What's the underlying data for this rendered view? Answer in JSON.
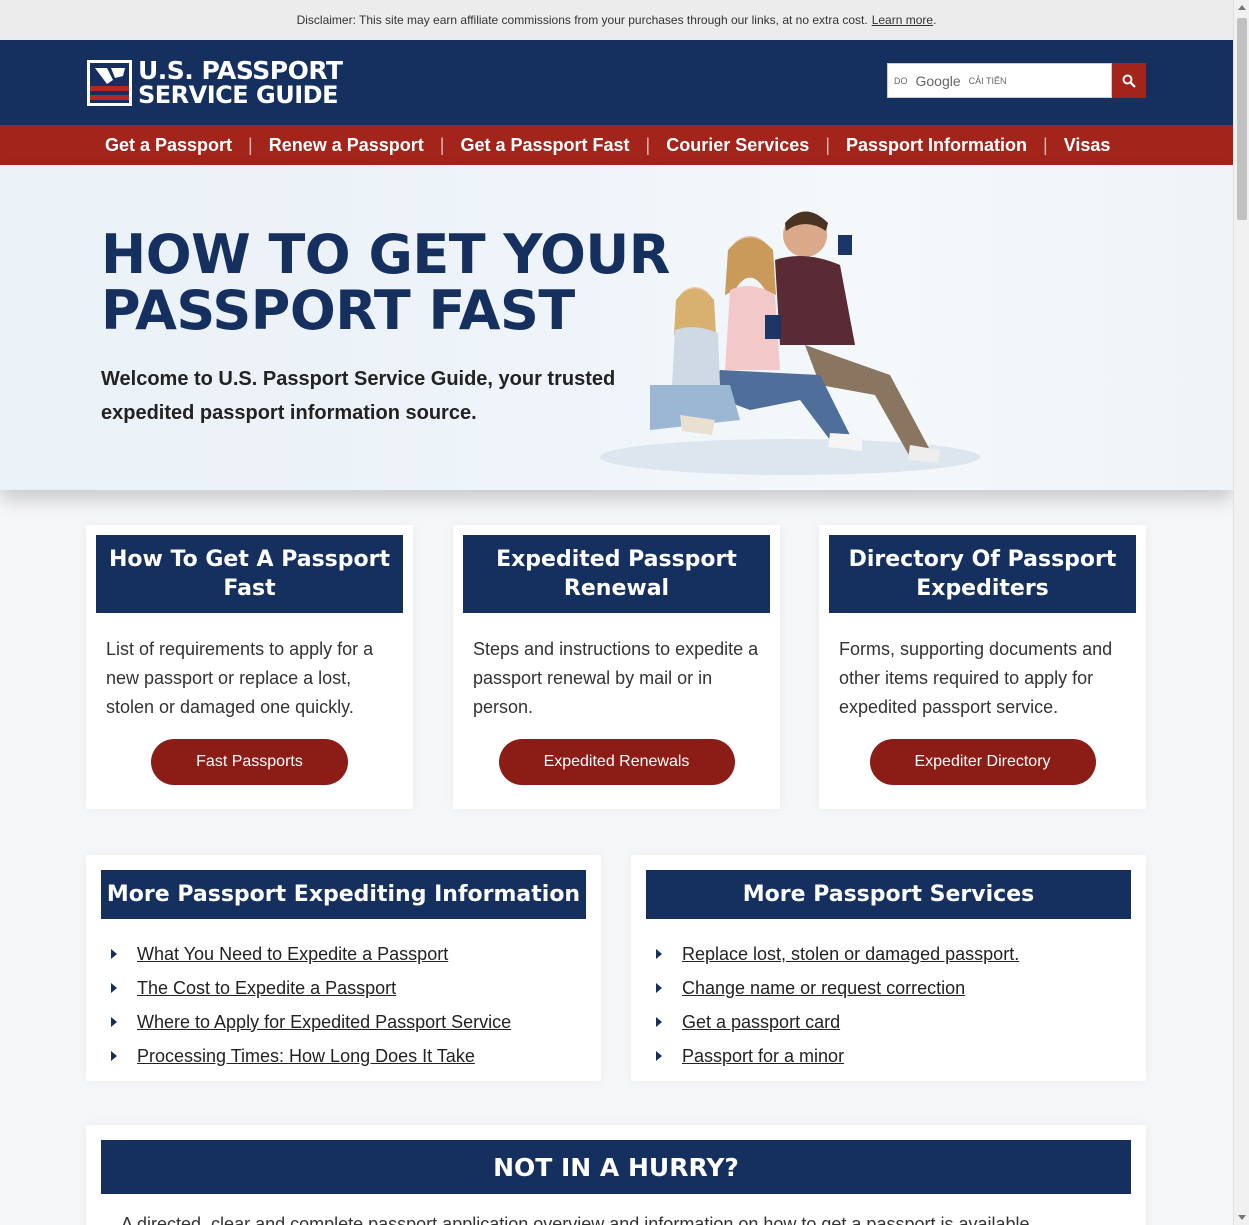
{
  "disclaimer": {
    "text": "Disclaimer: This site may earn affiliate commissions from your purchases through our links, at no extra cost.",
    "link": "Learn more",
    "end": "."
  },
  "header": {
    "logo_line1": "U.S. PASSPORT",
    "logo_line2": "SERVICE GUIDE",
    "search": {
      "by_label": "DO",
      "google_label": "Google",
      "enhanced_label": "CẢI TIẾN",
      "button_icon": "search-icon"
    }
  },
  "nav": {
    "items": [
      {
        "label": "Get a Passport"
      },
      {
        "label": "Renew a Passport"
      },
      {
        "label": "Get a Passport Fast"
      },
      {
        "label": "Courier Services"
      },
      {
        "label": "Passport Information"
      },
      {
        "label": "Visas"
      }
    ],
    "separator": "|"
  },
  "hero": {
    "title_line1": "HOW TO GET YOUR",
    "title_line2": "PASSPORT FAST",
    "intro": "Welcome to U.S. Passport Service Guide, your trusted expedited passport information source."
  },
  "cards": [
    {
      "title": "How To Get A Passport Fast",
      "body": "List of requirements to apply for a new passport or replace a lost, stolen or damaged one quickly.",
      "button": "Fast Passports"
    },
    {
      "title": "Expedited Passport Renewal",
      "body": "Steps and instructions to expedite a passport renewal by mail or in person.",
      "button": "Expedited Renewals"
    },
    {
      "title": "Directory Of Passport Expediters",
      "body": "Forms, supporting documents and other items required to apply for expedited passport service.",
      "button": "Expediter Directory"
    }
  ],
  "link_boxes": [
    {
      "title": "More Passport Expediting Information",
      "links": [
        "What You Need to Expedite a Passport",
        "The Cost to Expedite a Passport",
        "Where to Apply for Expedited Passport Service",
        "Processing Times: How Long Does It Take"
      ]
    },
    {
      "title": "More Passport Services",
      "links": [
        "Replace lost, stolen or damaged passport.",
        "Change name or request correction",
        "Get a passport card",
        "Passport for a minor"
      ]
    }
  ],
  "hurry": {
    "title": "NOT IN A HURRY?",
    "text": "A directed, clear and complete passport application overview and information on how to get a passport is available."
  },
  "colors": {
    "navy": "#15305f",
    "red_nav": "#a3241b",
    "red_button": "#8c1d16"
  }
}
